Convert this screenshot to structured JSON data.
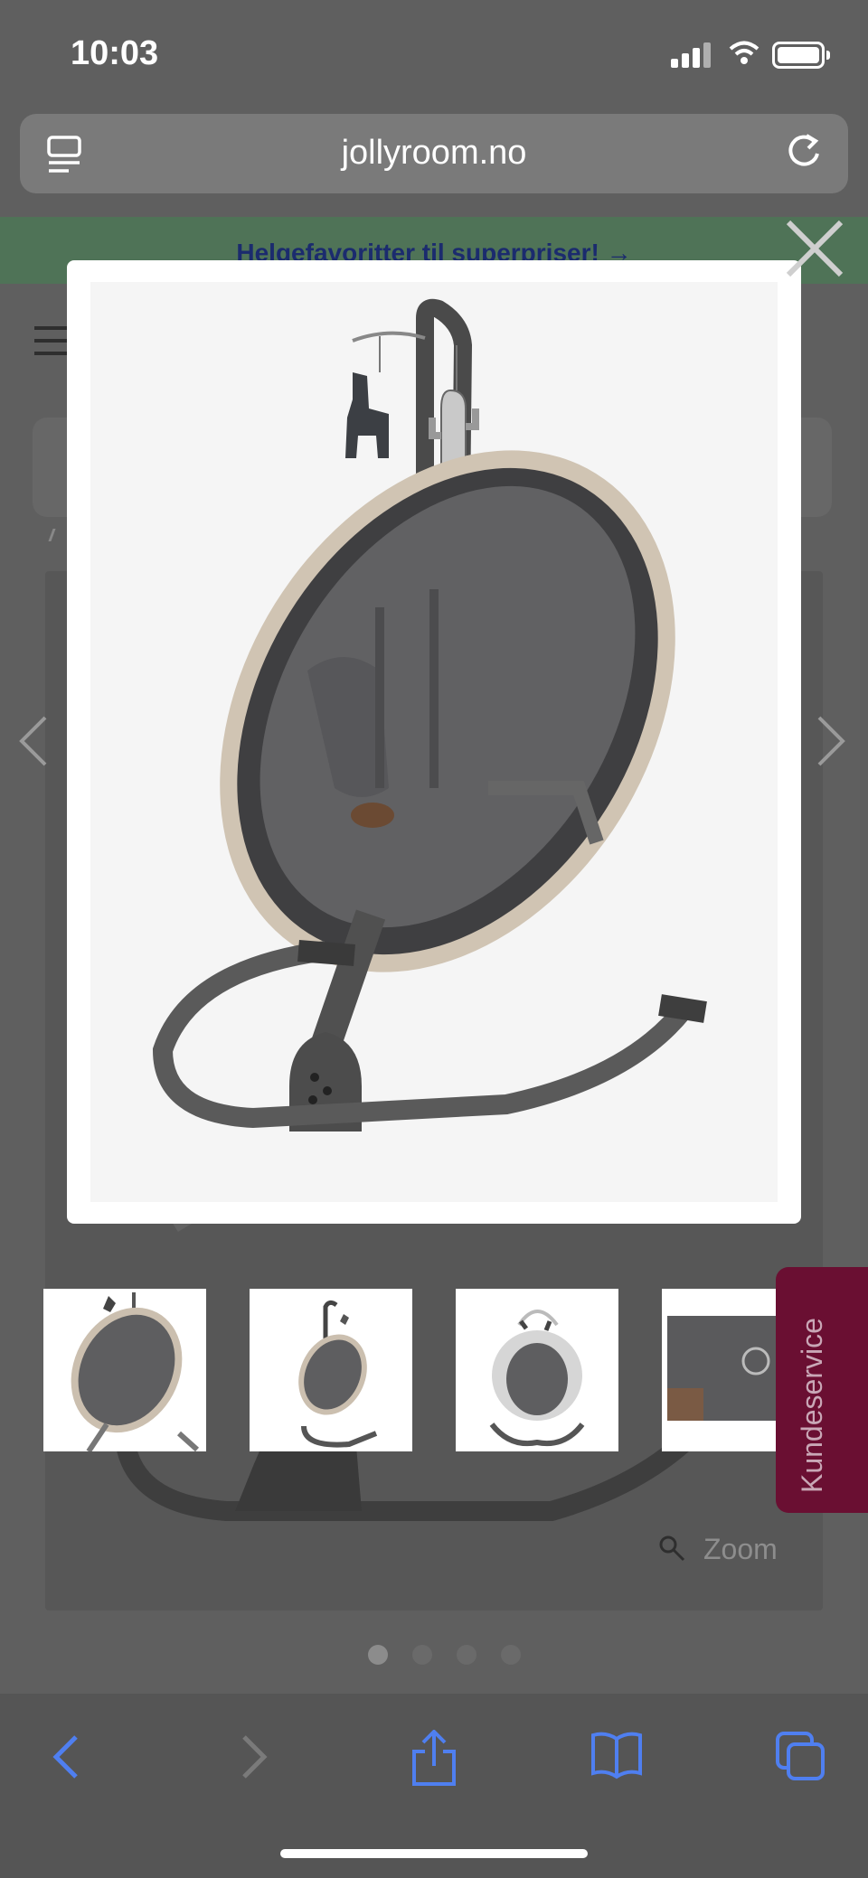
{
  "status_bar": {
    "time": "10:03"
  },
  "browser": {
    "url": "jollyroom.no"
  },
  "promo": {
    "text": "Helgefavoritter til superpriser! →"
  },
  "gallery": {
    "zoom_label": "Zoom",
    "dots": 4,
    "active_dot": 0,
    "thumbnails": [
      "thumbnail-1",
      "thumbnail-2",
      "thumbnail-3",
      "thumbnail-4"
    ]
  },
  "kundeservice": {
    "label": "Kundeservice"
  },
  "colors": {
    "accent": "#4f7ff0",
    "kundeservice": "#6a0f32",
    "promo_bg": "#4f7357"
  },
  "icons": {
    "reader": "reader-mode-icon",
    "reload": "reload-icon",
    "close": "close-icon",
    "prev": "chevron-left-icon",
    "next": "chevron-right-icon",
    "back": "back-icon",
    "forward": "forward-icon",
    "share": "share-icon",
    "bookmarks": "book-icon",
    "tabs": "tabs-icon",
    "zoom": "magnifier-icon"
  }
}
